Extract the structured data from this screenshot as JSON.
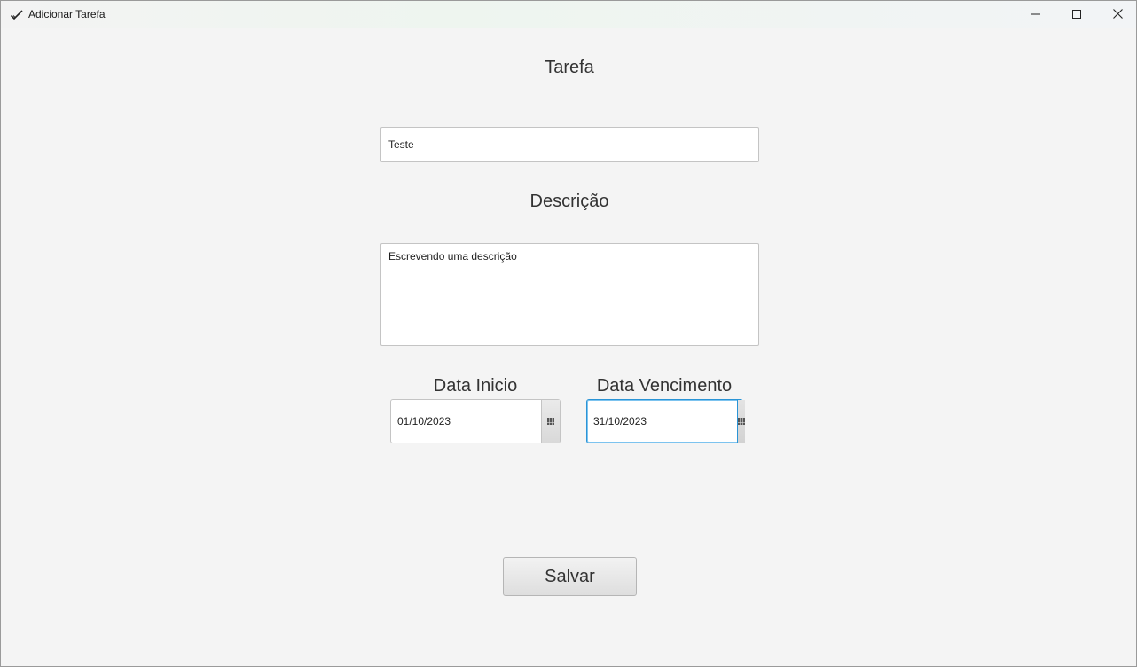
{
  "window": {
    "title": "Adicionar Tarefa"
  },
  "form": {
    "task_heading": "Tarefa",
    "task_value": "Teste",
    "description_heading": "Descrição",
    "description_value": "Escrevendo uma descrição",
    "start_date_heading": "Data Inicio",
    "start_date_value": "01/10/2023",
    "due_date_heading": "Data Vencimento",
    "due_date_value": "31/10/2023",
    "save_label": "Salvar"
  },
  "icons": {
    "app": "checkmark-icon",
    "minimize": "minimize-icon",
    "maximize": "maximize-icon",
    "close": "close-icon",
    "calendar": "calendar-icon"
  },
  "colors": {
    "background": "#f4f4f4",
    "focus_border": "#2a94d6",
    "text": "#333333"
  }
}
